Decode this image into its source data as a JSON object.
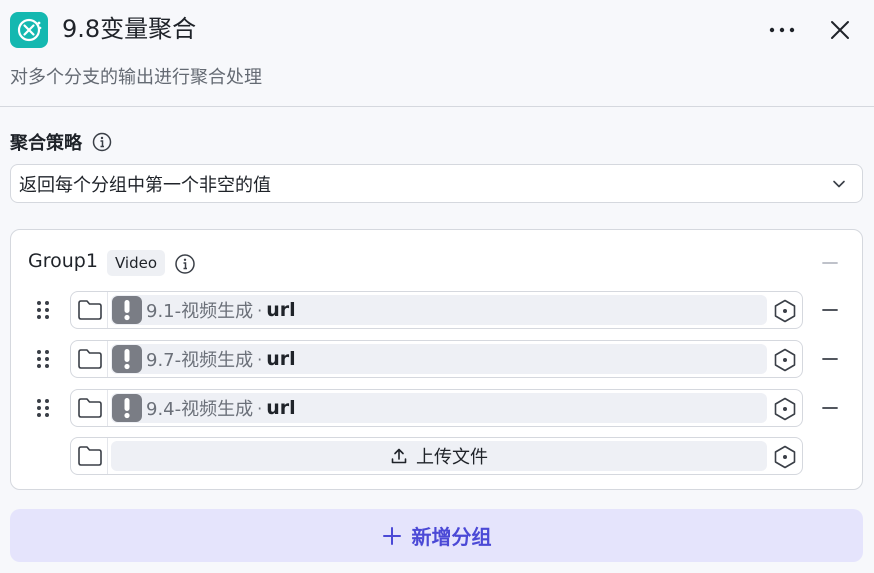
{
  "header": {
    "title": "9.8变量聚合",
    "subtitle": "对多个分支的输出进行聚合处理",
    "app_icon": "variable-aggregate-icon",
    "more_icon": "more-horizontal-icon",
    "close_icon": "close-icon"
  },
  "strategy": {
    "label": "聚合策略",
    "selected": "返回每个分组中第一个非空的值"
  },
  "group": {
    "name": "Group1",
    "type_tag": "Video",
    "variables": [
      {
        "node": "9.1-视频生成",
        "separator": "·",
        "field": "url"
      },
      {
        "node": "9.7-视频生成",
        "separator": "·",
        "field": "url"
      },
      {
        "node": "9.4-视频生成",
        "separator": "·",
        "field": "url"
      }
    ],
    "upload_label": "上传文件"
  },
  "add_group_label": "新增分组",
  "colors": {
    "accent": "#4b49d6",
    "accent_bg": "#e5e4fc",
    "app_icon_bg": "#14b8b0",
    "warning_bg": "#7a7d85"
  }
}
